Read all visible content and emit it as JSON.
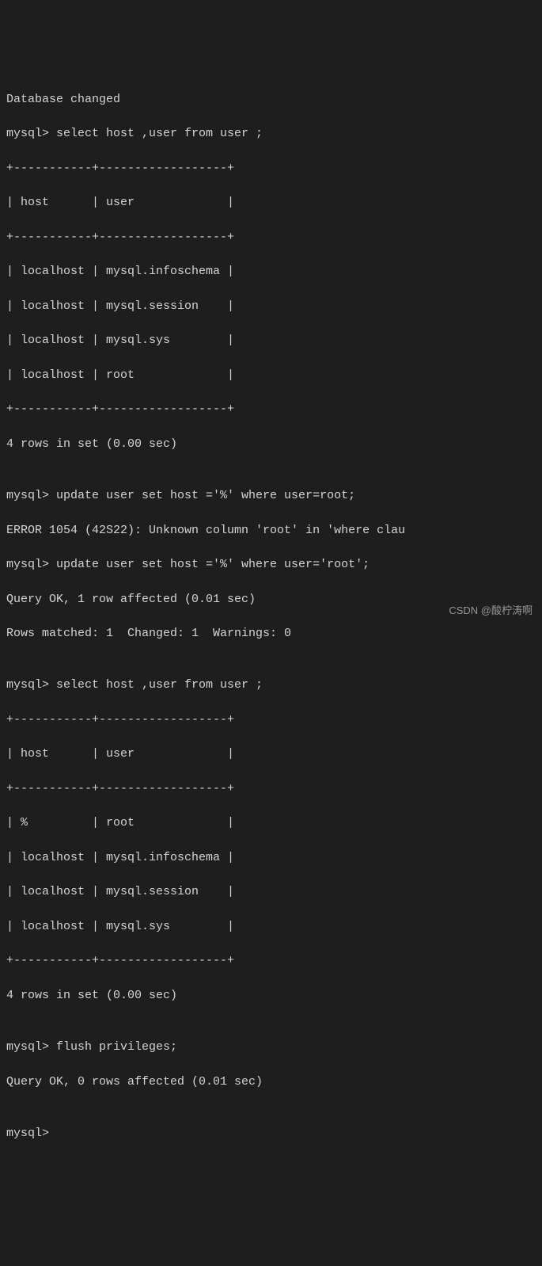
{
  "terminal": {
    "lines": [
      "Database changed",
      "mysql> select host ,user from user ;",
      "+-----------+------------------+",
      "| host      | user             |",
      "+-----------+------------------+",
      "| localhost | mysql.infoschema |",
      "| localhost | mysql.session    |",
      "| localhost | mysql.sys        |",
      "| localhost | root             |",
      "+-----------+------------------+",
      "4 rows in set (0.00 sec)",
      "",
      "mysql> update user set host ='%' where user=root;",
      "ERROR 1054 (42S22): Unknown column 'root' in 'where clau",
      "mysql> update user set host ='%' where user='root';",
      "Query OK, 1 row affected (0.01 sec)",
      "Rows matched: 1  Changed: 1  Warnings: 0",
      "",
      "mysql> select host ,user from user ;",
      "+-----------+------------------+",
      "| host      | user             |",
      "+-----------+------------------+",
      "| %         | root             |",
      "| localhost | mysql.infoschema |",
      "| localhost | mysql.session    |",
      "| localhost | mysql.sys        |",
      "+-----------+------------------+",
      "4 rows in set (0.00 sec)",
      "",
      "mysql> flush privileges;",
      "Query OK, 0 rows affected (0.01 sec)",
      "",
      "mysql>"
    ]
  },
  "watermark": "CSDN @酸柠涛啊"
}
